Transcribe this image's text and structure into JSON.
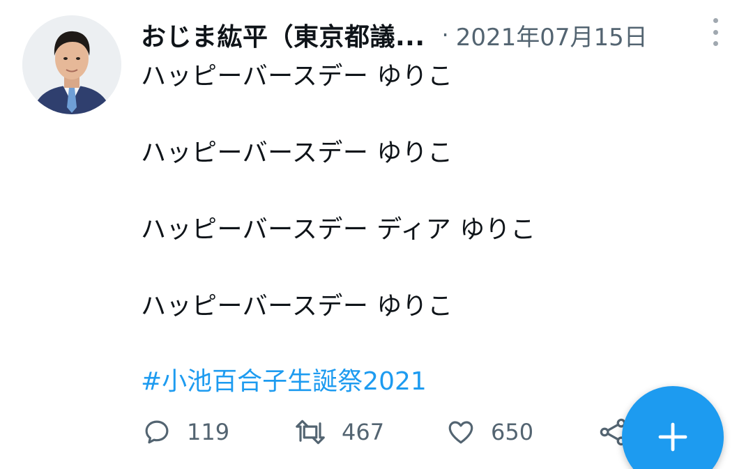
{
  "tweet": {
    "author_name": "おじま紘平（東京都議...",
    "separator": "·",
    "timestamp": "2021年07月15日",
    "lines": [
      "ハッピーバースデー ゆりこ",
      "ハッピーバースデー ゆりこ",
      "ハッピーバースデー ディア ゆりこ",
      "ハッピーバースデー ゆりこ"
    ],
    "hashtag": "#小池百合子生誕祭2021"
  },
  "actions": {
    "reply_count": "119",
    "retweet_count": "467",
    "like_count": "650"
  },
  "icons": {
    "more": "more-vertical-icon",
    "reply": "reply-icon",
    "retweet": "retweet-icon",
    "like": "heart-icon",
    "share": "share-icon",
    "compose": "plus-icon"
  },
  "colors": {
    "accent": "#1d9bf0",
    "text_primary": "#0f1419",
    "text_secondary": "#536471"
  }
}
